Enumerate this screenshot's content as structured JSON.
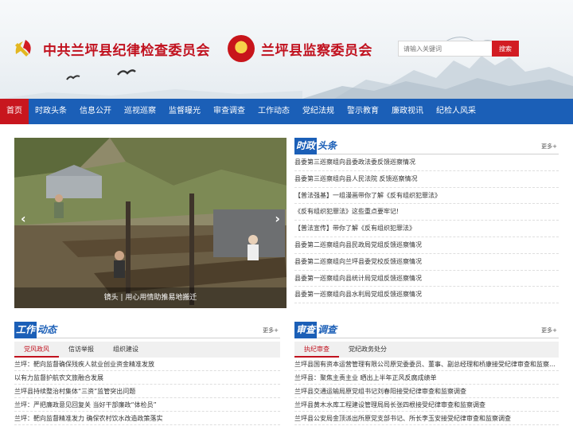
{
  "header": {
    "title_discipline": "中共兰坪县纪律检查委员会",
    "title_supervision": "兰坪县监察委员会",
    "search_placeholder": "请输入关键词",
    "search_button": "搜索"
  },
  "nav": [
    "首页",
    "时政头条",
    "信息公开",
    "巡视巡察",
    "监督曝光",
    "审查调查",
    "工作动态",
    "党纪法规",
    "警示教育",
    "廉政视讯",
    "纪检人风采"
  ],
  "slide": {
    "caption": "镜头 | 用心用情助推易地搬迁"
  },
  "headlines": {
    "title_a": "时政",
    "title_b": "头条",
    "more": "更多+",
    "items": [
      "县委第三巡察组向县委政法委反馈巡察情况",
      "县委第三巡察组向县人民法院 反馈巡察情况",
      "【普法强基】一组漫画带你了解《反有组织犯罪法》",
      "《反有组织犯罪法》这些重点要牢记!",
      "【普法宣传】带你了解《反有组织犯罪法》",
      "县委第二巡察组向县民政局党组反馈巡察情况",
      "县委第二巡察组向兰坪县委党校反馈巡察情况",
      "县委第一巡察组向县统计局党组反馈巡察情况",
      "县委第一巡察组向县水利局党组反馈巡察情况"
    ]
  },
  "work": {
    "title_a": "工作",
    "title_b": "动态",
    "more": "更多+",
    "tabs": [
      "党风政风",
      "信访举报",
      "组织建设"
    ],
    "items": [
      "兰坪：靶向监督确保残疾人就业创业资金精准发放",
      "以有力监督护航农文旅融合发展",
      "兰坪县持续整治村集体“三资”监管突出问题",
      "兰坪：严把廉政意见回复关 当好干部廉政“体检员”",
      "兰坪：靶向监督精准发力 确保农村饮水改造政策落实"
    ]
  },
  "review": {
    "title_a": "审查",
    "title_b": "调查",
    "more": "更多+",
    "tabs": [
      "执纪审查",
      "党纪政务处分"
    ],
    "items": [
      "兰坪县国有资本运营管理有限公司原党委委员、董事、副总经理和桥康接受纪律审查和监察调查",
      "兰坪县：聚焦主责主业 晒出上半年正风反腐成绩单",
      "兰坪县交通运输局原党组书记刘春阳接受纪律审查和监察调查",
      "兰坪县黄木水库工程建设管理局局长张四根接受纪律审查和监察调查",
      "兰坪县公安局金顶派出所原党支部书记、所长李玉安接受纪律审查和监察调查"
    ]
  },
  "colors": {
    "brand_red": "#c8161e",
    "nav_blue": "#1b5fb7"
  }
}
